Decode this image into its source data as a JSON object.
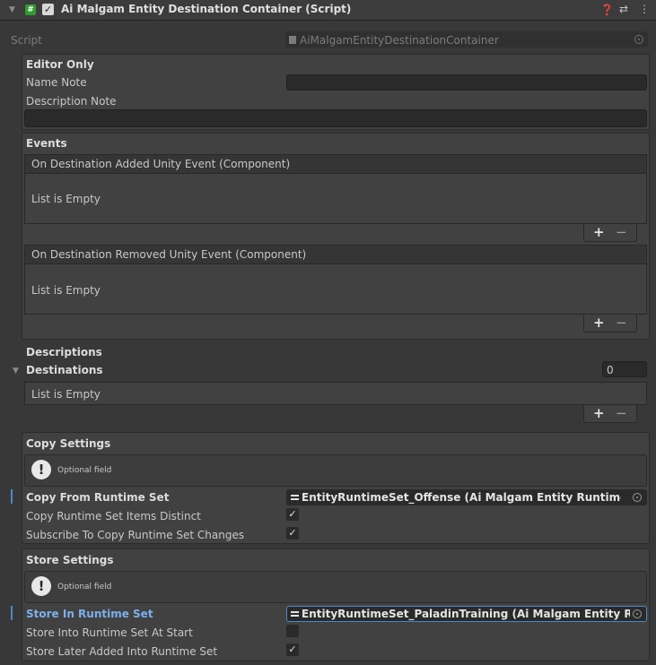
{
  "header": {
    "title": "Ai Malgam Entity Destination Container (Script)",
    "icons": [
      "foldout-arrow-icon",
      "script-icon",
      "enabled-checkbox",
      "help-icon",
      "presets-icon",
      "kebab-menu-icon"
    ]
  },
  "script_row": {
    "label": "Script",
    "value": "AiMalgamEntityDestinationContainer"
  },
  "editor_only": {
    "title": "Editor Only",
    "name_note_label": "Name Note",
    "name_note_value": "",
    "description_note_label": "Description Note",
    "description_note_value": ""
  },
  "events": {
    "title": "Events",
    "lists": [
      {
        "header": "On Destination Added Unity Event (Component)",
        "empty": "List is Empty"
      },
      {
        "header": "On Destination Removed Unity Event (Component)",
        "empty": "List is Empty"
      }
    ]
  },
  "descriptions": {
    "title": "Descriptions"
  },
  "destinations": {
    "title": "Destinations",
    "count": "0",
    "empty": "List is Empty"
  },
  "plus_label": "+",
  "minus_label": "−",
  "copy_settings": {
    "title": "Copy Settings",
    "help": "Optional field",
    "from_label": "Copy From Runtime Set",
    "from_value": "EntityRuntimeSet_Offense (Ai Malgam Entity Runtime Set)",
    "distinct_label": "Copy Runtime Set Items Distinct",
    "distinct_checked": true,
    "subscribe_label": "Subscribe To Copy Runtime Set Changes",
    "subscribe_checked": true
  },
  "store_settings": {
    "title": "Store Settings",
    "help": "Optional field",
    "in_label": "Store In Runtime Set",
    "in_value": "EntityRuntimeSet_PaladinTraining (Ai Malgam Entity Runtim",
    "at_start_label": "Store Into Runtime Set At Start",
    "at_start_checked": false,
    "later_label": "Store Later Added Into Runtime Set",
    "later_checked": true
  },
  "colors": {
    "background": "#383838",
    "accent": "#4a89c8",
    "script_icon": "#2f9b2f"
  }
}
